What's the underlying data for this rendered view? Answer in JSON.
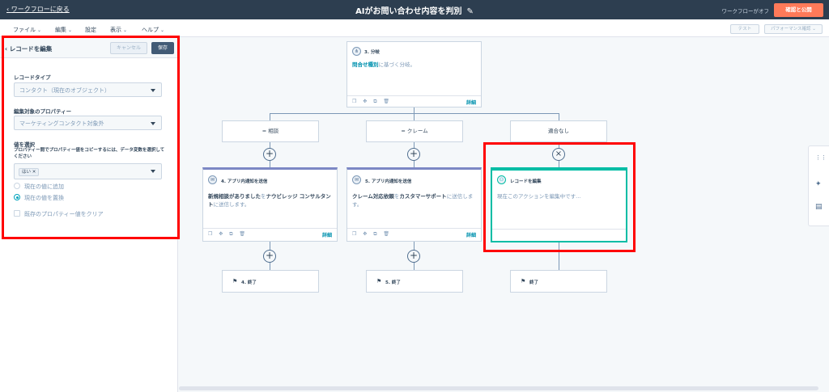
{
  "topbar": {
    "back_label": "ワークフローに戻る",
    "title": "AIがお問い合わせ内容を判別",
    "status": "ワークフローがオフ",
    "publish_label": "確認と公開"
  },
  "menu": {
    "items": [
      "ファイル",
      "編集",
      "設定",
      "表示",
      "ヘルプ"
    ],
    "test_label": "テスト",
    "performance_label": "パフォーマンス確認"
  },
  "panel": {
    "title": "レコードを編集",
    "cancel_label": "キャンセル",
    "save_label": "保存",
    "record_type_label": "レコードタイプ",
    "record_type_value": "コンタクト（現在のオブジェクト）",
    "property_label": "編集対象のプロパティー",
    "property_value": "マーケティングコンタクト対象外",
    "value_label": "値を選択",
    "value_help": "プロパティー間でプロパティー値をコピーするには、データ変数を選択してください",
    "value_tag": "はい",
    "option_append": "現在の値に追加",
    "option_replace": "現在の値を置換",
    "option_clear": "既存のプロパティー値をクリア"
  },
  "canvas": {
    "branch_node": {
      "title": "3. 分岐",
      "body_link": "問合せ種別",
      "body_rest": "に基づく分岐。",
      "detail": "詳細"
    },
    "branches": [
      "= 相談",
      "= クレーム",
      "適合なし"
    ],
    "notify_a": {
      "title": "4. アプリ内通知を送信",
      "body_bold": "新規相談がありました",
      "body_mid": "を",
      "body_bold2": "ナウビレッジ コンサルタント",
      "body_end": "に送信します。",
      "detail": "詳細"
    },
    "notify_b": {
      "title": "5. アプリ内通知を送信",
      "body_bold": "クレーム対応依頼",
      "body_mid": "を",
      "body_bold2": "カスタマーサポート",
      "body_end": "に送信します。",
      "detail": "詳細"
    },
    "edit_node": {
      "title": "レコードを編集",
      "body": "現在このアクションを編集中です..."
    },
    "ends": [
      "4. 終了",
      "5. 終了",
      "終了"
    ]
  }
}
